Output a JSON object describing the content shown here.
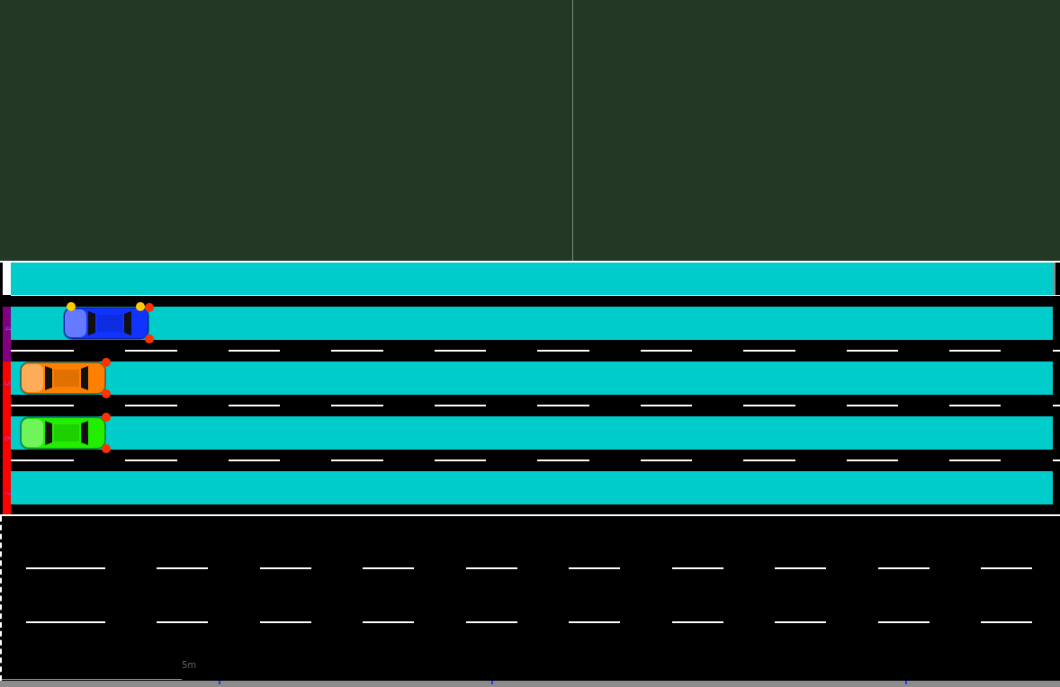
{
  "lanes": [
    {
      "label": "",
      "color": "#ffffff"
    },
    {
      "label": "4",
      "color": "#800080"
    },
    {
      "label": "5",
      "color": "#ff0000"
    },
    {
      "label": "6",
      "color": "#ff0000"
    },
    {
      "label": "7",
      "color": "#ff0000"
    }
  ],
  "cars": [
    {
      "lane": "4",
      "color": "#1133ff",
      "left_signal": true,
      "braking": true
    },
    {
      "lane": "5",
      "color": "#ff8000",
      "left_signal": false,
      "braking": true
    },
    {
      "lane": "6",
      "color": "#22ee00",
      "left_signal": false,
      "braking": true
    }
  ],
  "scale": {
    "label": "5m"
  }
}
